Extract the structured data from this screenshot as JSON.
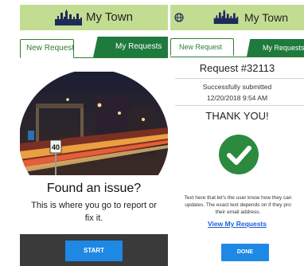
{
  "app": {
    "title": "My Town",
    "accent_green": "#1f7a3d",
    "appbar_color": "#c2dd91",
    "button_color": "#1e88e5"
  },
  "left": {
    "tabs": {
      "active": "New Request",
      "inactive": "My Requests"
    },
    "hero": {
      "sign_speed": "40"
    },
    "heading": "Found an issue?",
    "description": "This is where you go to report or fix it.",
    "start_label": "START"
  },
  "right": {
    "tabs": {
      "active": "New Request",
      "inactive": "My Requests"
    },
    "request_title": "Request #32113",
    "status": "Successfully submitted",
    "timestamp": "12/20/2018 9:54 AM",
    "thanks": "THANK YOU!",
    "body_line1": "Text here that let's the user know how they can",
    "body_line2": "updates. The exact text depends on if they pro",
    "body_line3": "their email address.",
    "link_label": "View My Requests",
    "done_label": "DONE"
  },
  "icons": {
    "skyline": "city-skyline-icon",
    "globe": "globe-icon",
    "check": "check-circle-icon"
  }
}
